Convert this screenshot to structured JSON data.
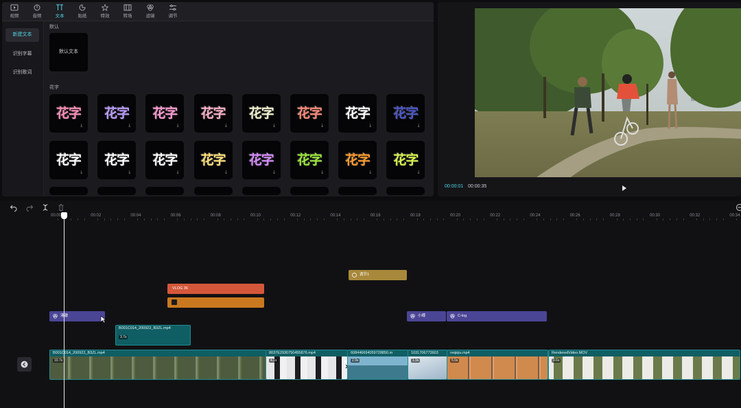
{
  "toolbar": {
    "items": [
      {
        "label": "视频",
        "icon": "video-icon"
      },
      {
        "label": "音频",
        "icon": "audio-icon"
      },
      {
        "label": "文本",
        "icon": "text-icon",
        "active": true
      },
      {
        "label": "贴纸",
        "icon": "sticker-icon"
      },
      {
        "label": "特效",
        "icon": "effects-icon"
      },
      {
        "label": "转场",
        "icon": "transition-icon"
      },
      {
        "label": "滤镜",
        "icon": "filter-icon"
      },
      {
        "label": "调节",
        "icon": "adjust-icon"
      }
    ]
  },
  "sidebar": {
    "items": [
      {
        "label": "新建文本",
        "active": true
      },
      {
        "label": "识别字幕"
      },
      {
        "label": "识别歌词"
      }
    ]
  },
  "library": {
    "default_section": "默认",
    "default_card": "默认文本",
    "flower_section": "花字",
    "tile_text": "花字",
    "tile_colors_row1": [
      "#ff8cb8",
      "#b99cff",
      "#ff9ad1",
      "#ffb0c8",
      "#f2f2d0",
      "#ff8a7a",
      "#ffffff",
      "#4b56c8"
    ],
    "tile_colors_row2": [
      "#ffffff",
      "#ffffff",
      "#ffffff",
      "#ffe07a",
      "#d68bff",
      "#9ae63a",
      "#ff9a2a",
      "#d7f24a"
    ]
  },
  "player": {
    "current_time": "00:00:01",
    "total_time": "00:00:35",
    "play_icon": "play-icon"
  },
  "timeline": {
    "controls": [
      "undo-icon",
      "redo-icon",
      "split-icon",
      "delete-icon"
    ],
    "ruler": [
      "00:00",
      "00:02",
      "00:04",
      "00:06",
      "00:08",
      "00:10",
      "00:12",
      "00:14",
      "00:16",
      "00:18",
      "00:20",
      "00:22",
      "00:24",
      "00:26",
      "00:28",
      "00:30",
      "00:32",
      "00:34"
    ],
    "adjust_clip": "调节1",
    "text_clip": "VLOG 36",
    "filter_clip_1": "清澈",
    "filter_clip_2": "小樽",
    "filter_clip_3": "C-log",
    "pip_clip": {
      "name": "B001C014_200922_B3ZL.mp4",
      "duration": "3.7s"
    },
    "main_clips": [
      {
        "name": "B001C014_200922_B3ZL.mp4",
        "duration": "10.7s"
      },
      {
        "name": "8037E2930750455876.mp4",
        "duration": "4.1s"
      },
      {
        "name": "608446694059728850.m",
        "duration": "2.9s"
      },
      {
        "name": "1031706773603",
        "duration": "1.9s"
      },
      {
        "name": "reqiqiu.mp4",
        "duration": "5.0s"
      },
      {
        "name": "RenderedVideo.MOV",
        "duration": "9.6s"
      }
    ],
    "colors": {
      "accent": "#4fd2e6",
      "text_clip": "#d4573a",
      "sticker_clip": "#c9781f",
      "adjust_clip": "#a8893c",
      "filter_clip": "#4b4596",
      "video_clip": "#0f5e63"
    }
  }
}
